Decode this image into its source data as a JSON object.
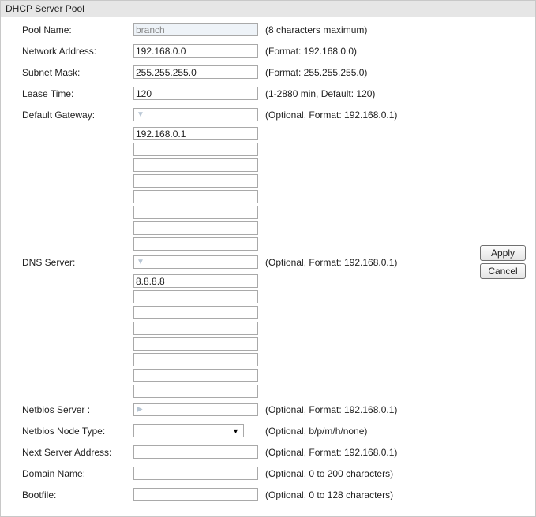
{
  "panel": {
    "title": "DHCP Server Pool"
  },
  "pool_name": {
    "label": "Pool Name:",
    "value": "branch",
    "hint": "(8 characters maximum)"
  },
  "network_address": {
    "label": "Network Address:",
    "value": "192.168.0.0",
    "hint": "(Format: 192.168.0.0)"
  },
  "subnet_mask": {
    "label": "Subnet Mask:",
    "value": "255.255.255.0",
    "hint": "(Format: 255.255.255.0)"
  },
  "lease_time": {
    "label": "Lease Time:",
    "value": "120",
    "hint": "(1-2880 min, Default: 120)"
  },
  "default_gateway": {
    "label": "Default Gateway:",
    "hint": "(Optional, Format: 192.168.0.1)",
    "entries": [
      "192.168.0.1",
      "",
      "",
      "",
      "",
      "",
      "",
      ""
    ]
  },
  "dns_server": {
    "label": "DNS Server:",
    "hint": "(Optional, Format: 192.168.0.1)",
    "entries": [
      "8.8.8.8",
      "",
      "",
      "",
      "",
      "",
      "",
      ""
    ]
  },
  "netbios_server": {
    "label": "Netbios Server :",
    "value": "",
    "hint": "(Optional, Format: 192.168.0.1)"
  },
  "netbios_node_type": {
    "label": "Netbios Node Type:",
    "value": "",
    "hint": "(Optional, b/p/m/h/none)"
  },
  "next_server_address": {
    "label": "Next Server Address:",
    "value": "",
    "hint": "(Optional, Format: 192.168.0.1)"
  },
  "domain_name": {
    "label": "Domain Name:",
    "value": "",
    "hint": "(Optional, 0 to 200 characters)"
  },
  "bootfile": {
    "label": "Bootfile:",
    "value": "",
    "hint": "(Optional, 0 to 128 characters)"
  },
  "buttons": {
    "apply": "Apply",
    "cancel": "Cancel"
  },
  "icons": {
    "combo_arrow": "triangle-down-icon",
    "netbios_arrow": "triangle-right-icon",
    "select_caret": "caret-down-icon"
  }
}
